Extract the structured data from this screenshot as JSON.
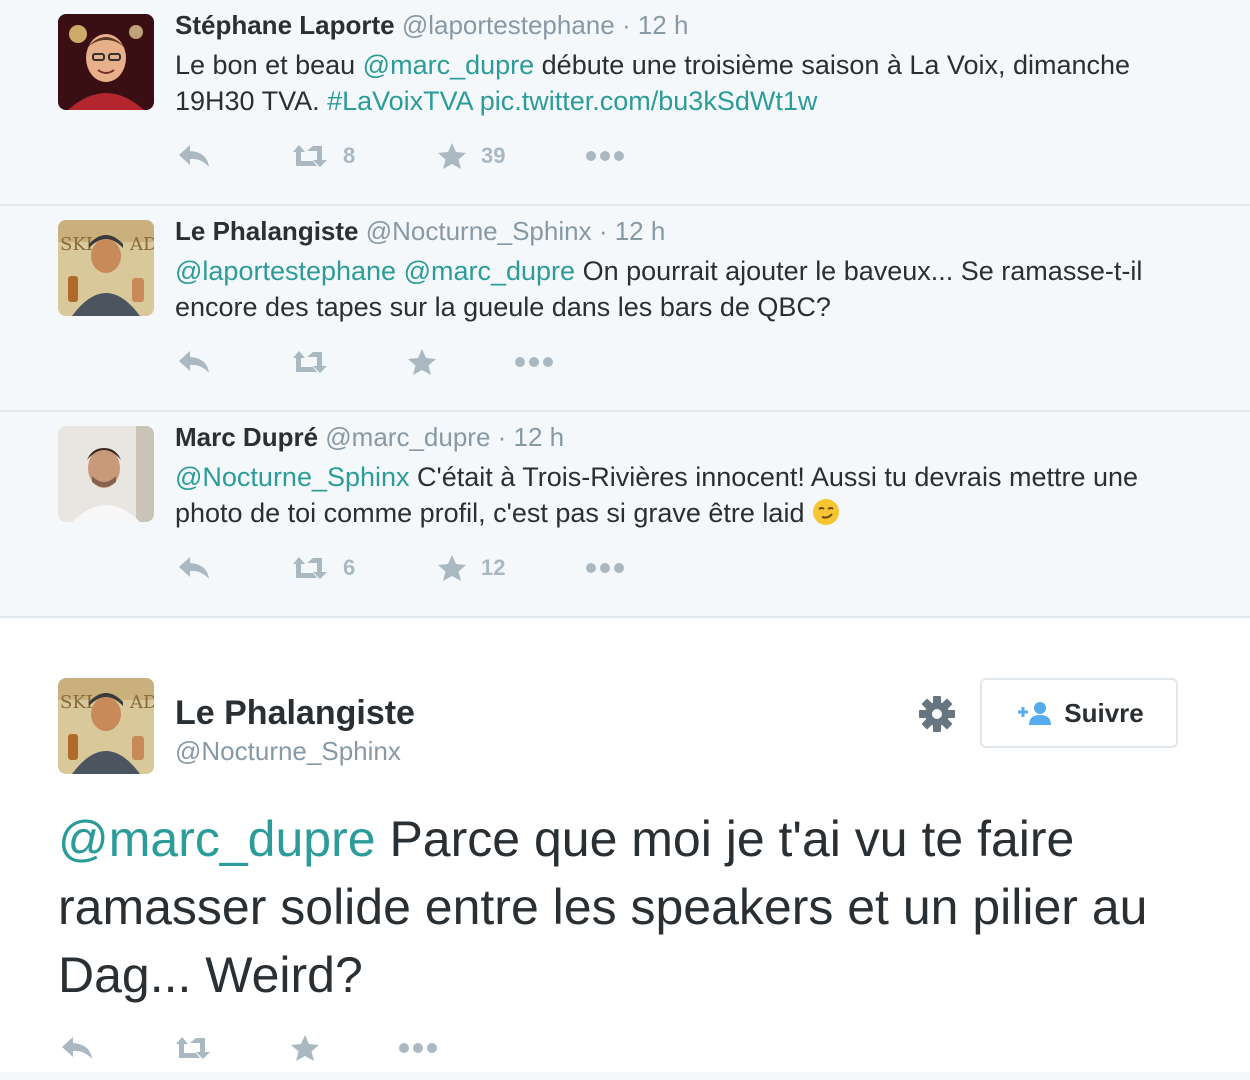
{
  "tweets": [
    {
      "name": "Stéphane Laporte",
      "handle": "@laportestephane",
      "time": "· 12 h",
      "text": {
        "p1": "Le bon et beau ",
        "m1": "@marc_dupre",
        "p2": " débute une troisième saison à La Voix, dimanche 19H30 TVA. ",
        "m2": "#LaVoixTVA",
        "p3": " ",
        "m3": "pic.twitter.com/bu3kSdWt1w"
      },
      "retweets": "8",
      "favorites": "39"
    },
    {
      "name": "Le Phalangiste",
      "handle": "@Nocturne_Sphinx",
      "time": "· 12 h",
      "text": {
        "m1": "@laportestephane",
        "p1": " ",
        "m2": "@marc_dupre",
        "p2": " On pourrait ajouter le baveux... Se ramasse-t-il encore des tapes sur la gueule dans les bars de QBC?"
      },
      "retweets": "",
      "favorites": ""
    },
    {
      "name": "Marc Dupré",
      "handle": "@marc_dupre",
      "time": "· 12 h",
      "text": {
        "m1": "@Nocturne_Sphinx",
        "p1": " C'était à Trois-Rivières innocent! Aussi tu devrais mettre une photo de toi comme profil, c'est pas si grave être laid "
      },
      "retweets": "6",
      "favorites": "12"
    }
  ],
  "focus": {
    "name": "Le Phalangiste",
    "handle": "@Nocturne_Sphinx",
    "follow_label": "Suivre",
    "mention": "@marc_dupre",
    "text": " Parce que moi je t'ai vu te faire ramasser solide entre les speakers et un pilier au Dag... Weird?"
  },
  "icons": {
    "reply": "reply-icon",
    "retweet": "retweet-icon",
    "favorite": "star-icon",
    "more": "more-icon",
    "settings": "gear-icon",
    "follow": "add-user-icon"
  },
  "colors": {
    "link": "#2b9c9a",
    "muted": "#8899a6",
    "action": "#aab8c2",
    "follow_icon": "#55acee"
  }
}
